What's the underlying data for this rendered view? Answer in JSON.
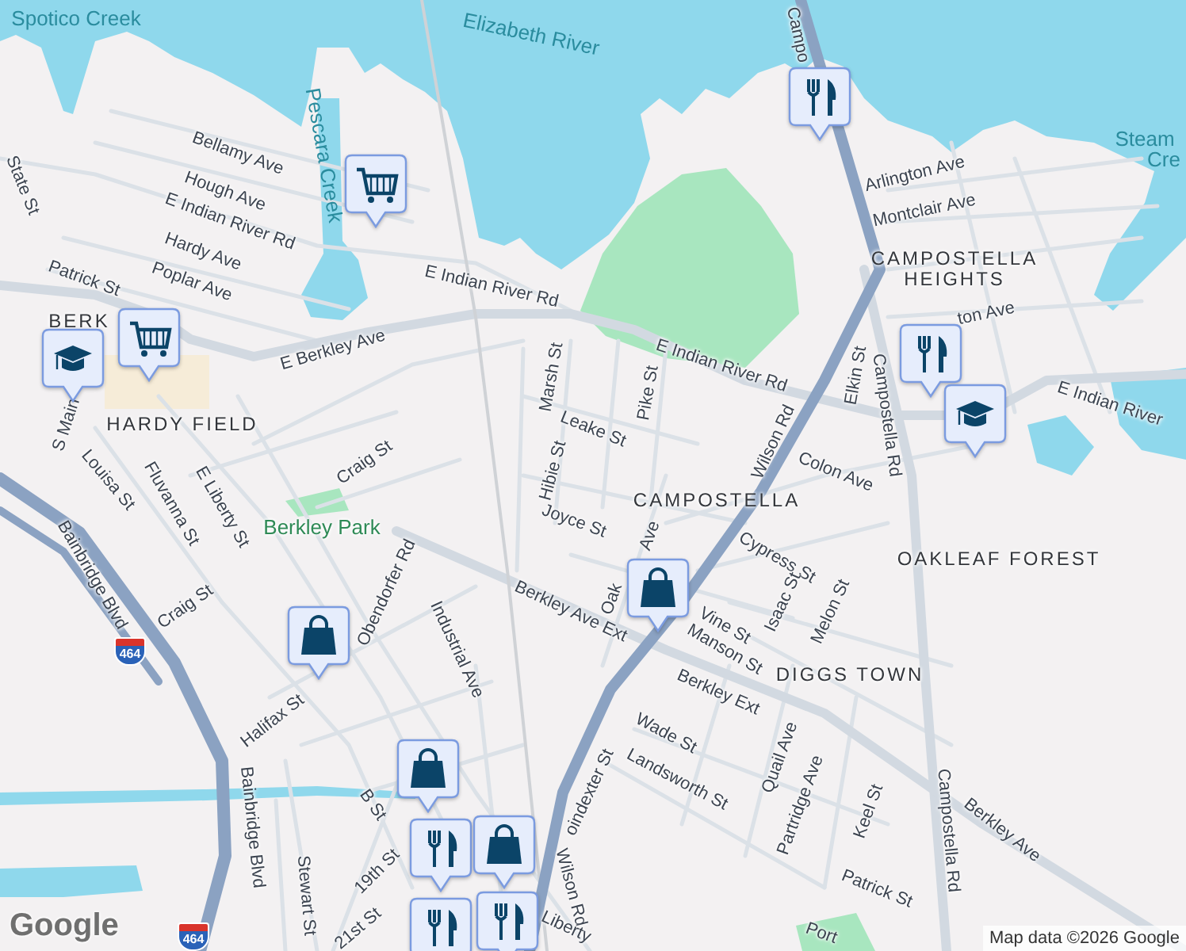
{
  "map": {
    "labels": [
      {
        "text": "Spotico Creek",
        "kind": "water"
      },
      {
        "text": "Elizabeth River",
        "kind": "water"
      },
      {
        "text": "Pescara Creek",
        "kind": "water"
      },
      {
        "text": "Steam",
        "kind": "water"
      },
      {
        "text": "Cre",
        "kind": "water"
      },
      {
        "text": "State St",
        "kind": "street"
      },
      {
        "text": "Bellamy Ave",
        "kind": "street"
      },
      {
        "text": "Hough Ave",
        "kind": "street"
      },
      {
        "text": "E Indian River Rd",
        "kind": "street"
      },
      {
        "text": "Hardy Ave",
        "kind": "street"
      },
      {
        "text": "Patrick St",
        "kind": "street"
      },
      {
        "text": "Poplar Ave",
        "kind": "street"
      },
      {
        "text": "E Indian River Rd",
        "kind": "street"
      },
      {
        "text": "E Berkley Ave",
        "kind": "street"
      },
      {
        "text": "BERK",
        "kind": "neighborhood"
      },
      {
        "text": "HARDY FIELD",
        "kind": "neighborhood"
      },
      {
        "text": "Marsh St",
        "kind": "street"
      },
      {
        "text": "Campo",
        "kind": "street"
      },
      {
        "text": "Arlington Ave",
        "kind": "street"
      },
      {
        "text": "Montclair Ave",
        "kind": "street"
      },
      {
        "text": "CAMPOSTELLA HEIGHTS",
        "kind": "neighborhood"
      },
      {
        "text": "ton Ave",
        "kind": "street"
      },
      {
        "text": "E Indian River Rd",
        "kind": "street"
      },
      {
        "text": "Pike St",
        "kind": "street"
      },
      {
        "text": "Leake St",
        "kind": "street"
      },
      {
        "text": "Wilson Rd",
        "kind": "street"
      },
      {
        "text": "Elkin St",
        "kind": "street"
      },
      {
        "text": "Campostella Rd",
        "kind": "street"
      },
      {
        "text": "E Indian River",
        "kind": "street"
      },
      {
        "text": "Colon Ave",
        "kind": "street"
      },
      {
        "text": "S Main",
        "kind": "street"
      },
      {
        "text": "Craig St",
        "kind": "street"
      },
      {
        "text": "Hibie St",
        "kind": "street"
      },
      {
        "text": "Louisa St",
        "kind": "street"
      },
      {
        "text": "Fluvanna St",
        "kind": "street"
      },
      {
        "text": "E Liberty St",
        "kind": "street"
      },
      {
        "text": "CAMPOSTELLA",
        "kind": "neighborhood"
      },
      {
        "text": "Joyce St",
        "kind": "street"
      },
      {
        "text": "Berkley Park",
        "kind": "park"
      },
      {
        "text": "OAKLEAF FOREST",
        "kind": "neighborhood"
      },
      {
        "text": "Cypress St",
        "kind": "street"
      },
      {
        "text": "Oak",
        "kind": "street"
      },
      {
        "text": "Ave",
        "kind": "street"
      },
      {
        "text": "Vine St",
        "kind": "street"
      },
      {
        "text": "Isaac St",
        "kind": "street"
      },
      {
        "text": "Melon St",
        "kind": "street"
      },
      {
        "text": "Manson St",
        "kind": "street"
      },
      {
        "text": "Berkley Ave Ext",
        "kind": "street"
      },
      {
        "text": "Berkley Ext",
        "kind": "street"
      },
      {
        "text": "DIGGS TOWN",
        "kind": "neighborhood"
      },
      {
        "text": "Obendorfer Rd",
        "kind": "street"
      },
      {
        "text": "Industrial Ave",
        "kind": "street"
      },
      {
        "text": "Craig St",
        "kind": "street"
      },
      {
        "text": "Bainbridge Blvd",
        "kind": "street"
      },
      {
        "text": "Halifax St",
        "kind": "street"
      },
      {
        "text": "Bainbridge Blvd",
        "kind": "street"
      },
      {
        "text": "oindexter St",
        "kind": "street"
      },
      {
        "text": "Wade St",
        "kind": "street"
      },
      {
        "text": "Landsworth St",
        "kind": "street"
      },
      {
        "text": "Quail Ave",
        "kind": "street"
      },
      {
        "text": "Partridge Ave",
        "kind": "street"
      },
      {
        "text": "Keel St",
        "kind": "street"
      },
      {
        "text": "Campostella Rd",
        "kind": "street"
      },
      {
        "text": "Berkley Ave",
        "kind": "street"
      },
      {
        "text": "Patrick St",
        "kind": "street"
      },
      {
        "text": "B St",
        "kind": "street"
      },
      {
        "text": "19th St",
        "kind": "street"
      },
      {
        "text": "Stewart St",
        "kind": "street"
      },
      {
        "text": "21st St",
        "kind": "street"
      },
      {
        "text": "Wilson Rd",
        "kind": "street"
      },
      {
        "text": "Liberty",
        "kind": "street"
      },
      {
        "text": "Port",
        "kind": "street"
      }
    ],
    "shields": [
      {
        "text": "464"
      },
      {
        "text": "464"
      }
    ],
    "pins": [
      {
        "kind": "cart"
      },
      {
        "kind": "restaurant"
      },
      {
        "kind": "school"
      },
      {
        "kind": "cart"
      },
      {
        "kind": "restaurant"
      },
      {
        "kind": "school"
      },
      {
        "kind": "bag"
      },
      {
        "kind": "bag"
      },
      {
        "kind": "bag"
      },
      {
        "kind": "restaurant"
      },
      {
        "kind": "bag"
      },
      {
        "kind": "restaurant"
      },
      {
        "kind": "restaurant"
      }
    ]
  },
  "logo": "Google",
  "attribution": "Map data ©2026 Google"
}
